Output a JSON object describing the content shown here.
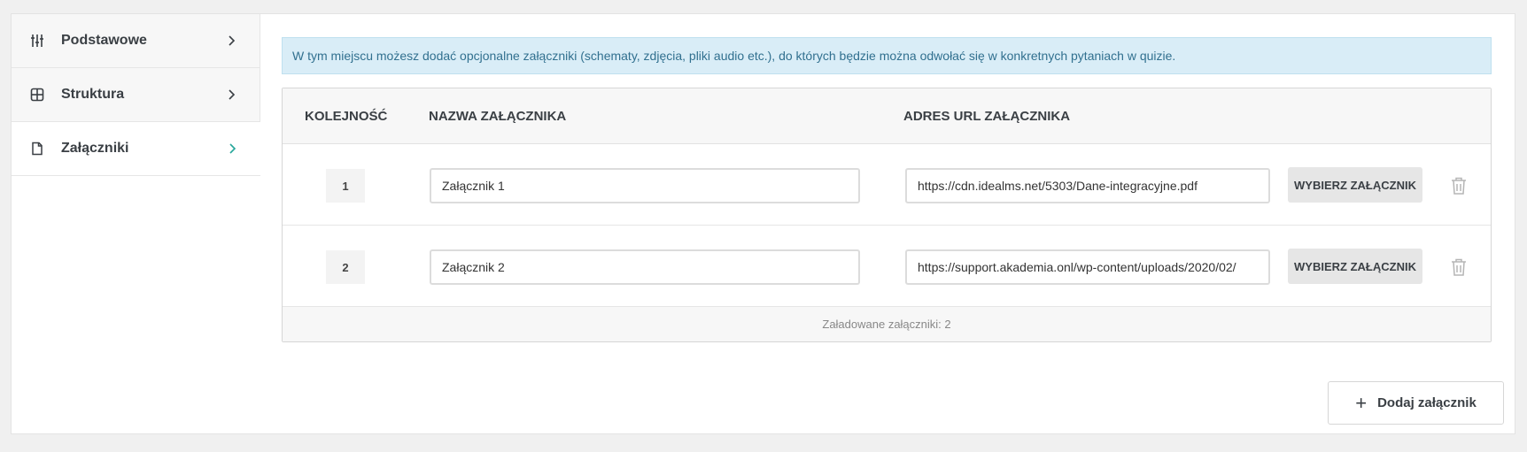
{
  "sidebar": {
    "items": [
      {
        "label": "Podstawowe",
        "icon": "sliders-icon",
        "active": false
      },
      {
        "label": "Struktura",
        "icon": "grid-icon",
        "active": false
      },
      {
        "label": "Załączniki",
        "icon": "file-icon",
        "active": true
      }
    ]
  },
  "info": {
    "text": "W tym miejscu możesz dodać opcjonalne załączniki (schematy, zdjęcia, pliki audio etc.), do których będzie można odwołać się w konkretnych pytaniach w quizie."
  },
  "table": {
    "headers": {
      "order": "KOLEJNOŚĆ",
      "name": "NAZWA ZAŁĄCZNIKA",
      "url": "ADRES URL ZAŁĄCZNIKA"
    },
    "rows": [
      {
        "order": "1",
        "name": "Załącznik 1",
        "url": "https://cdn.idealms.net/5303/Dane-integracyjne.pdf",
        "pick_label": "WYBIERZ ZAŁĄCZNIK"
      },
      {
        "order": "2",
        "name": "Załącznik 2",
        "url": "https://support.akademia.onl/wp-content/uploads/2020/02/",
        "pick_label": "WYBIERZ ZAŁĄCZNIK"
      }
    ],
    "footer": "Załadowane załączniki: 2"
  },
  "add_button": {
    "label": "Dodaj załącznik"
  },
  "colors": {
    "accent": "#26a69a",
    "info_bg": "#d9edf7",
    "info_text": "#31708f"
  }
}
